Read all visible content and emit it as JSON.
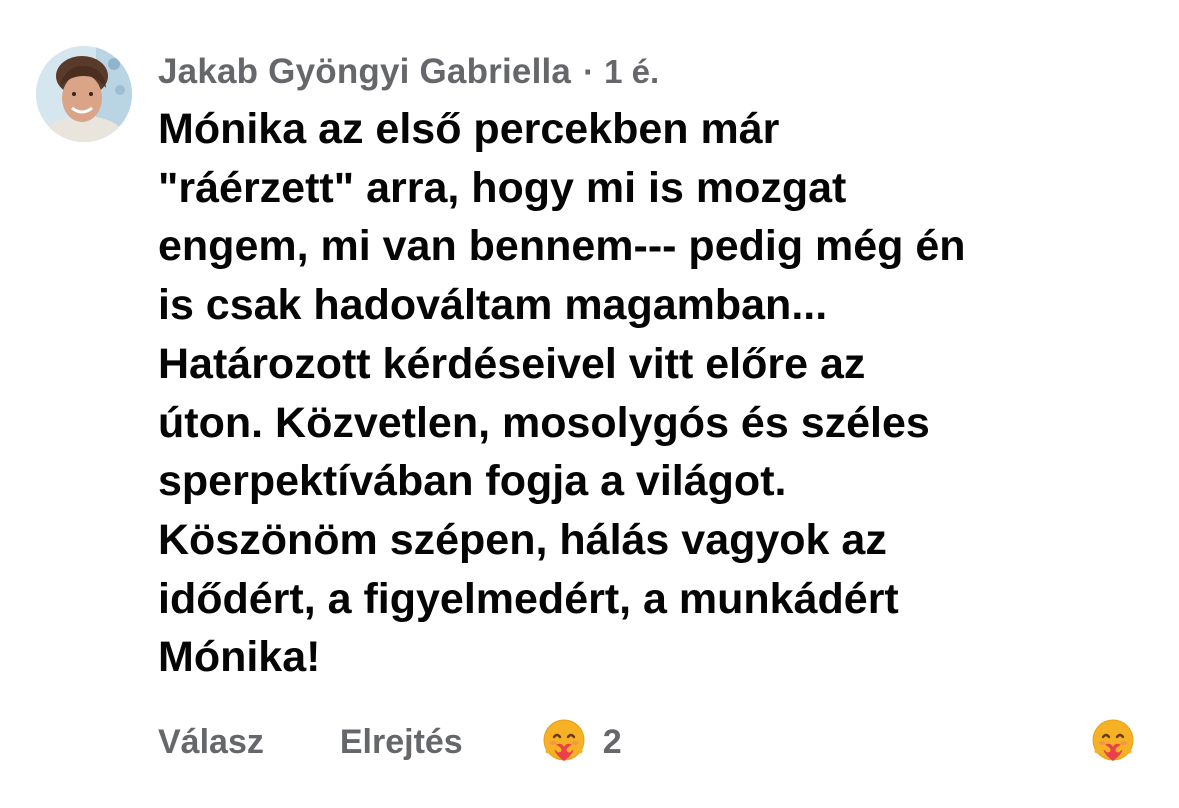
{
  "comment": {
    "author": "Jakab Gyöngyi Gabriella",
    "separator": "·",
    "time": "1 é.",
    "lines": [
      "Mónika az első percekben már",
      "\"ráérzett\" arra, hogy mi is mozgat",
      "engem, mi van bennem--- pedig még én",
      "is csak hadováltam magamban...",
      "Határozott kérdéseivel vitt előre az",
      "úton. Közvetlen, mosolygós és széles",
      "sperpektívában fogja a világot.",
      "Köszönöm szépen, hálás vagyok az",
      "idődért, a figyelmedért, a munkádért",
      "Mónika!"
    ],
    "avatar_icon": "profile-photo",
    "actions": {
      "reply_label": "Válasz",
      "hide_label": "Elrejtés"
    },
    "reaction": {
      "icon": "care-reaction-icon",
      "count": "2"
    },
    "react_button_icon": "care-reaction-icon"
  },
  "colors": {
    "text_primary": "#050505",
    "text_secondary": "#65676b",
    "background": "#ffffff",
    "care_face": "#f7b125",
    "care_heart": "#e9404a"
  }
}
